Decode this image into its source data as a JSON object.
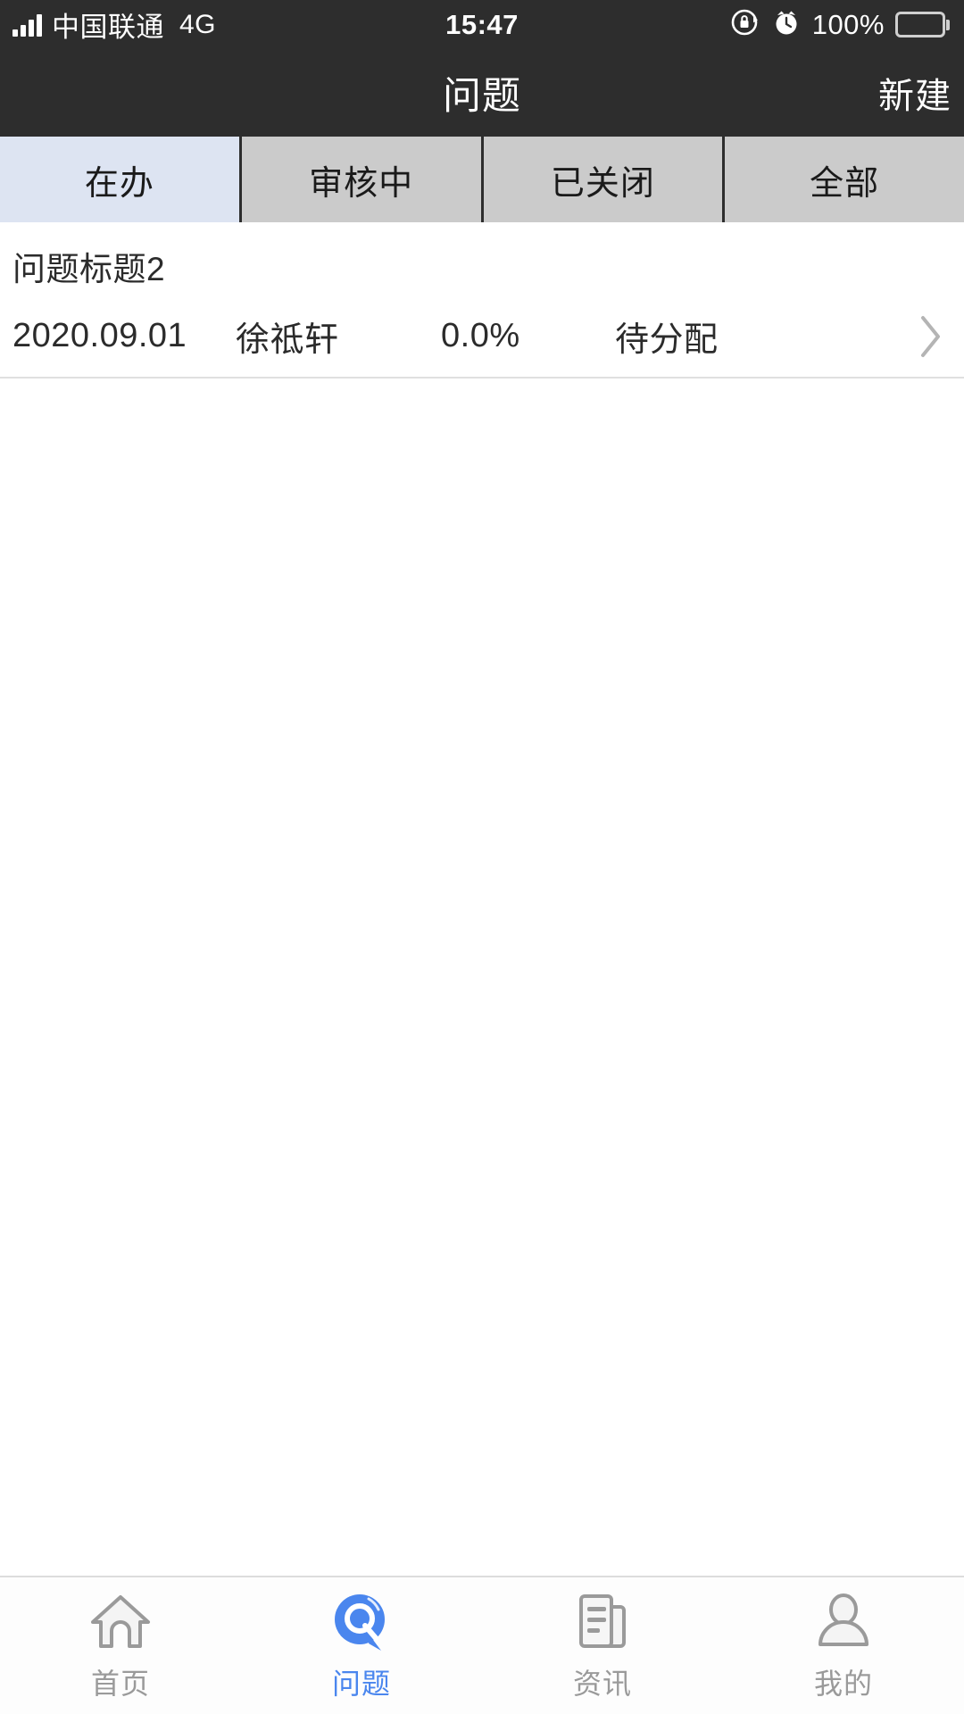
{
  "status_bar": {
    "carrier": "中国联通",
    "network": "4G",
    "time": "15:47",
    "battery_percent": "100%",
    "icons": [
      "signal-bars-icon",
      "rotation-lock-icon",
      "alarm-clock-icon",
      "battery-icon"
    ]
  },
  "nav_bar": {
    "title": "问题",
    "action_label": "新建"
  },
  "segment_tabs": {
    "active_index": 0,
    "items": [
      {
        "label": "在办"
      },
      {
        "label": "审核中"
      },
      {
        "label": "已关闭"
      },
      {
        "label": "全部"
      }
    ]
  },
  "list": {
    "items": [
      {
        "title": "问题标题2",
        "date": "2020.09.01",
        "owner": "徐祗轩",
        "progress": "0.0%",
        "status": "待分配"
      }
    ]
  },
  "tab_bar": {
    "active_index": 1,
    "items": [
      {
        "label": "首页",
        "icon": "home-icon"
      },
      {
        "label": "问题",
        "icon": "question-bubble-icon"
      },
      {
        "label": "资讯",
        "icon": "news-icon"
      },
      {
        "label": "我的",
        "icon": "person-icon"
      }
    ]
  },
  "colors": {
    "bar_background": "#2d2d2d",
    "tab_inactive_background": "#cbcbcb",
    "tab_active_background": "#dde4f2",
    "accent_blue": "#4a86ee",
    "icon_gray": "#9a9a9a"
  }
}
